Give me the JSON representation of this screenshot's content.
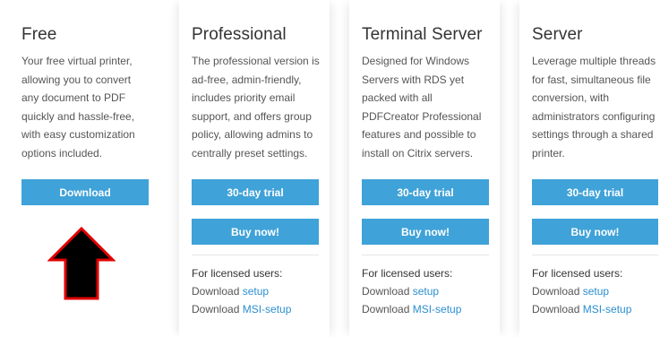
{
  "plans": [
    {
      "name": "Free",
      "description": [
        "Your free virtual printer,",
        "allowing you to convert",
        "any document to PDF",
        "quickly and hassle-free,",
        "with easy customization",
        "options included."
      ],
      "primary_button": "Download"
    },
    {
      "name": "Professional",
      "description": [
        "The professional version is",
        "ad-free, admin-friendly,",
        "includes priority email",
        "support, and offers group",
        "policy, allowing admins to",
        "centrally preset settings."
      ],
      "primary_button": "30-day trial",
      "secondary_button": "Buy now!"
    },
    {
      "name": "Terminal Server",
      "description": [
        "Designed for Windows",
        "Servers with RDS yet",
        "packed with all",
        "PDFCreator Professional",
        "features and possible to",
        "install on Citrix servers."
      ],
      "primary_button": "30-day trial",
      "secondary_button": "Buy now!"
    },
    {
      "name": "Server",
      "description": [
        "Leverage multiple threads",
        "for fast, simultaneous file",
        "conversion, with",
        "administrators configuring",
        "settings through a shared",
        "printer."
      ],
      "primary_button": "30-day trial",
      "secondary_button": "Buy now!"
    }
  ],
  "licensed": {
    "heading": "For licensed users:",
    "download_prefix": "Download",
    "setup_link": "setup",
    "msi_link": "MSI-setup"
  },
  "colors": {
    "button": "#3fa2d8",
    "link": "#2b8fd0",
    "arrow_fill": "#000000",
    "arrow_outline": "#e00000"
  },
  "annotation": {
    "icon": "up-arrow-icon"
  }
}
